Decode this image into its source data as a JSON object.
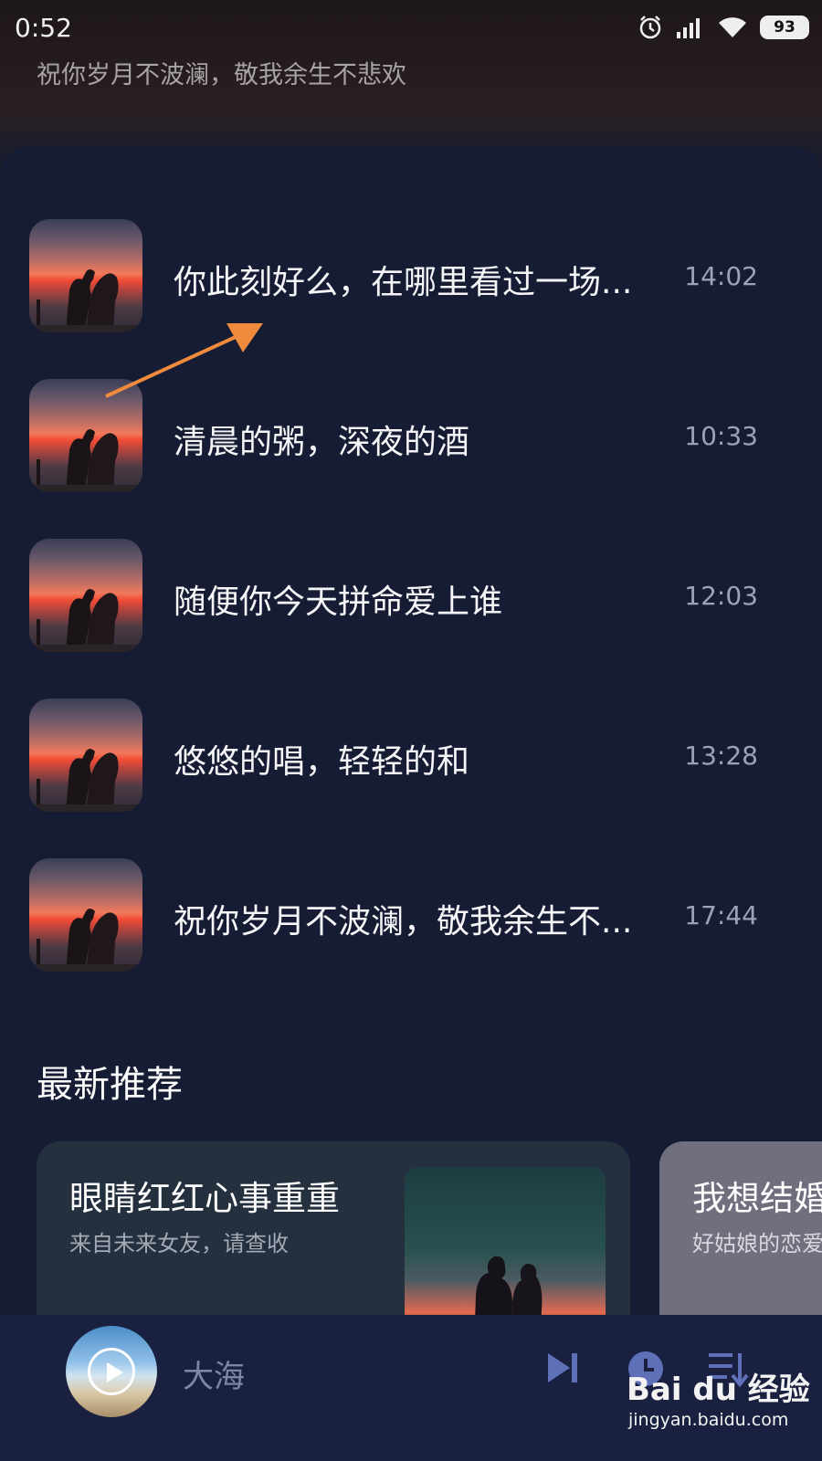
{
  "status_bar": {
    "time": "0:52",
    "battery": "93",
    "icons": [
      "alarm-icon",
      "signal-icon",
      "wifi-icon",
      "battery-icon"
    ]
  },
  "header": {
    "subtitle": "祝你岁月不波澜，敬我余生不悲欢"
  },
  "songs": [
    {
      "title": "你此刻好么，在哪里看过一场...",
      "time": "14:02"
    },
    {
      "title": "清晨的粥，深夜的酒",
      "time": "10:33"
    },
    {
      "title": "随便你今天拼命爱上谁",
      "time": "12:03"
    },
    {
      "title": "悠悠的唱，轻轻的和",
      "time": "13:28"
    },
    {
      "title": "祝你岁月不波澜，敬我余生不...",
      "time": "17:44"
    }
  ],
  "recommend": {
    "section_title": "最新推荐",
    "cards": [
      {
        "title": "眼睛红红心事重重",
        "subtitle": "来自未来女友，请查收"
      },
      {
        "title": "我想结婚",
        "subtitle": "好姑娘的恋爱"
      }
    ]
  },
  "player": {
    "track": "大海",
    "controls": [
      "next-icon",
      "timer-icon",
      "playlist-icon"
    ]
  },
  "watermark": {
    "logo": "Bai du 经验",
    "url": "jingyan.baidu.com"
  },
  "colors": {
    "sheet_bg": "#161c33",
    "player_bg": "#1a2140",
    "accent_arrow": "#f08a3c"
  }
}
